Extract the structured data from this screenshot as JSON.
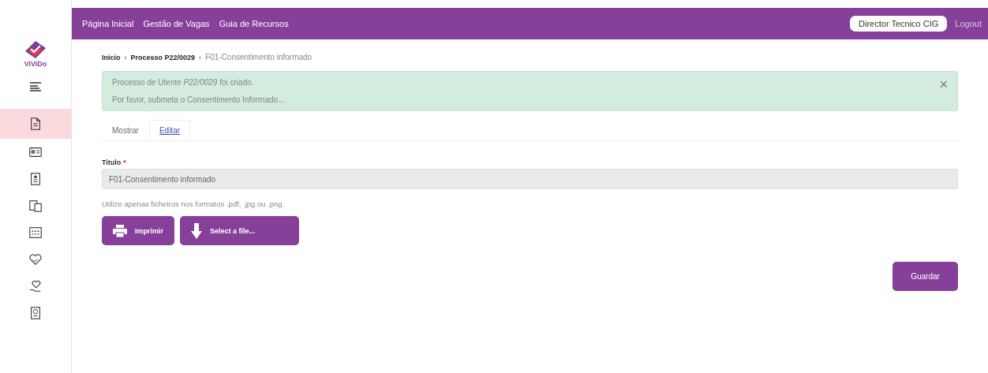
{
  "sidebar": {
    "logo": "ViViDo",
    "items": [
      {
        "selected": true
      },
      {
        "selected": false
      },
      {
        "selected": false
      },
      {
        "selected": false
      },
      {
        "selected": false
      },
      {
        "selected": false
      },
      {
        "selected": false
      },
      {
        "selected": false
      }
    ]
  },
  "topbar": {
    "nav": [
      "Página Inicial",
      "Gestão de Vagas",
      "Guia de Recursos"
    ],
    "user": "Director Tecnico CIG",
    "logout": "Logout"
  },
  "breadcrumb": {
    "separator": "‹",
    "items": [
      "Inicio",
      "Processo P22/0029",
      "F01-Consentimento informado"
    ]
  },
  "alert": {
    "lines": [
      "Processo de Utente *P22/0029* foi criado.",
      "Por favor, submeta o Consentimento Informado..."
    ],
    "close": "×"
  },
  "tabs": [
    {
      "label": "Mostrar",
      "selected": false
    },
    {
      "label": "Editar",
      "selected": true
    }
  ],
  "form": {
    "label": "Titulo",
    "required": "*",
    "value": "F01-Consentimento informado",
    "hint": "Utilize apenas ficheiros nos formatos .pdf, .jpg ou .png.",
    "buttons": [
      {
        "kind": "print",
        "label": "Imprimir"
      },
      {
        "kind": "upload",
        "label": "Select a file..."
      }
    ],
    "save": "Guardar"
  }
}
